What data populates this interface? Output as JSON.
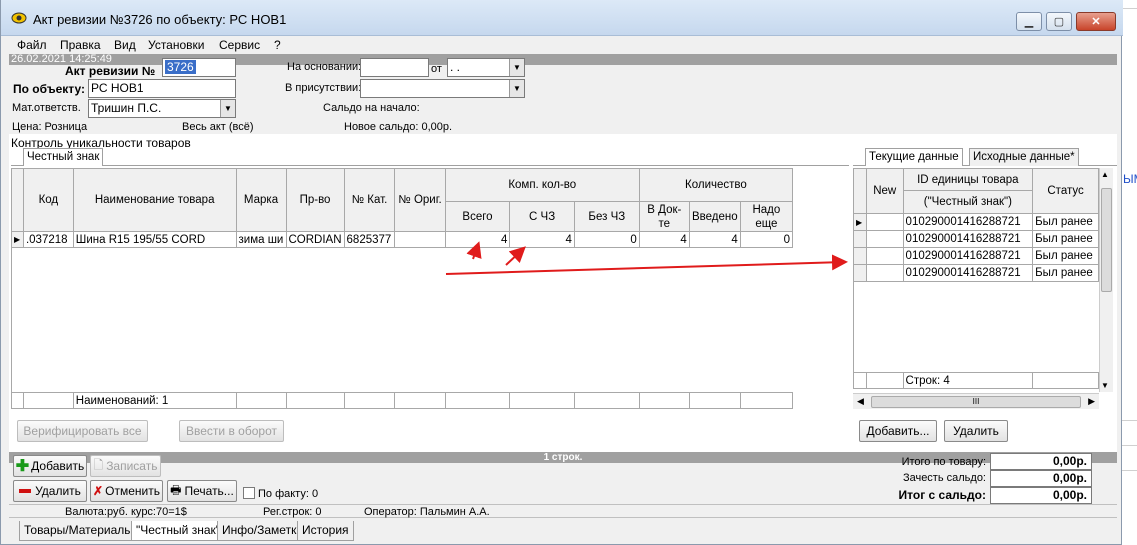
{
  "window": {
    "title": "Акт ревизии №3726 по объекту: РС НОВ1",
    "min_label": "▁",
    "max_label": "▢",
    "close_label": "✕"
  },
  "menu": [
    "Файл",
    "Правка",
    "Вид",
    "Установки",
    "Сервис",
    "?"
  ],
  "datestamp": "26.02.2021 14:25:49",
  "form": {
    "act_label": "Акт ревизии №",
    "act_number": "3726",
    "object_label": "По объекту:",
    "object_value": "РС НОВ1",
    "resp_label": "Мат.ответств.",
    "resp_value": "Тришин П.С.",
    "basis_label": "На основании:",
    "basis_value": "",
    "from_label": "от",
    "from_value": " .  .",
    "presence_label": "В присутствии:",
    "presence_value": "",
    "saldo_start_label": "Сальдо на начало:",
    "price_label": "Цена: Розница",
    "act_all_label": "Весь акт (всё)",
    "new_saldo_label": "Новое сальдо: 0,00р."
  },
  "section_title": "Контроль уникальности товаров",
  "left_tab": "Честный знак",
  "right_tabs": [
    "Текущие данные",
    "Исходные данные*"
  ],
  "main_table": {
    "headers": {
      "code": "Код",
      "name": "Наименование товара",
      "brand": "Марка",
      "maker": "Пр-во",
      "cat": "№ Кат.",
      "orig": "№ Ориг.",
      "comp_group": "Комп. кол-во",
      "comp_total": "Всего",
      "comp_cz": "С ЧЗ",
      "comp_nocz": "Без ЧЗ",
      "qty_group": "Количество",
      "qty_doc": "В Док-те",
      "qty_entered": "Введено",
      "qty_need": "Надо еще"
    },
    "rows": [
      {
        "code": ".037218",
        "name": "Шина R15 195/55 CORD",
        "brand": "зима ши",
        "maker": "CORDIAN",
        "cat": "6825377",
        "orig": "",
        "comp_total": "4",
        "comp_cz": "4",
        "comp_nocz": "0",
        "qty_doc": "4",
        "qty_entered": "4",
        "qty_need": "0"
      }
    ],
    "footer": "Наименований: 1"
  },
  "right_table": {
    "headers": {
      "new": "New",
      "id": "ID единицы товара",
      "id_sub": "(\"Честный знак\")",
      "status": "Статус"
    },
    "rows": [
      {
        "new": "",
        "id": "010290001416288721",
        "status": "Был ранее"
      },
      {
        "new": "",
        "id": "010290001416288721",
        "status": "Был ранее"
      },
      {
        "new": "",
        "id": "010290001416288721",
        "status": "Был ранее"
      },
      {
        "new": "",
        "id": "010290001416288721",
        "status": "Был ранее"
      }
    ],
    "footer": "Строк: 4",
    "hscroll_thumb": "III"
  },
  "buttons": {
    "verify_all": "Верифицировать все",
    "enter_turnover": "Ввести в оборот",
    "add_right": "Добавить...",
    "delete_right": "Удалить",
    "add": "Добавить",
    "save": "Записать",
    "delete": "Удалить",
    "cancel": "Отменить",
    "print": "Печать...",
    "by_fact": "По факту: 0"
  },
  "status_rows": "1 строк.",
  "totals": {
    "item_label": "Итого по товару:",
    "item_value": "0,00р.",
    "saldo_label": "Зачесть сальдо:",
    "saldo_value": "0,00р.",
    "total_label": "Итог с сальдо:",
    "total_value": "0,00р."
  },
  "info": {
    "currency": "Валюта:руб. курс:70=1$",
    "reg_rows": "Рег.строк: 0",
    "operator": "Оператор: Пальмин А.А."
  },
  "bottom_tabs": [
    "Товары/Материалы",
    "\"Честный знак\"",
    "Инфо/Заметки",
    "История"
  ],
  "side_fragment": "ЫМ",
  "colors": {
    "accent_red": "#e01b1b",
    "selection": "#3a6ec8"
  }
}
